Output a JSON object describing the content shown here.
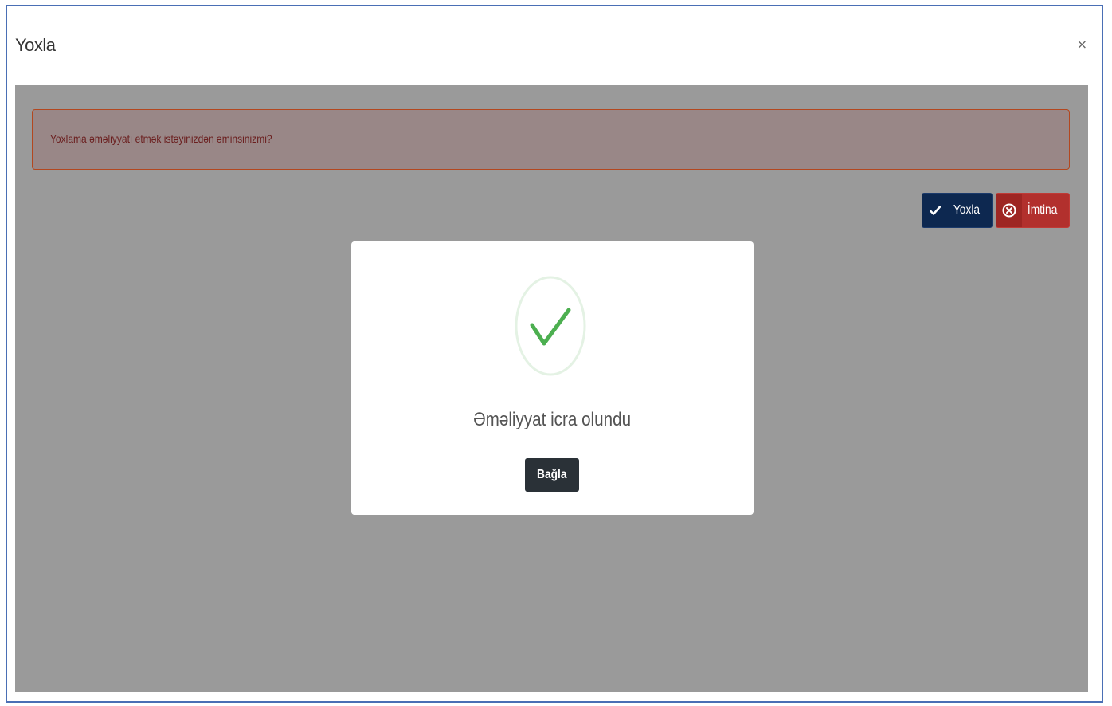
{
  "modal": {
    "title": "Yoxla",
    "close_symbol": "×"
  },
  "alert": {
    "text": "Yoxlama əməliyyatı etmək istəyinizdən əminsinizmi?"
  },
  "actions": {
    "confirm_label": "Yoxla",
    "confirm_icon": "check-icon",
    "cancel_label": "İmtina",
    "cancel_icon": "circle-x-icon"
  },
  "success_dialog": {
    "icon": "success-check-icon",
    "message": "Əməliyyat icra olundu",
    "close_label": "Bağla"
  },
  "colors": {
    "frame_border": "#4a6fb5",
    "overlay": "#9a9a9a",
    "alert_border": "#b3471f",
    "confirm_button": "#0d2850",
    "cancel_button": "#b2302d",
    "success_green": "#4caf50",
    "close_button": "#2a3137"
  }
}
